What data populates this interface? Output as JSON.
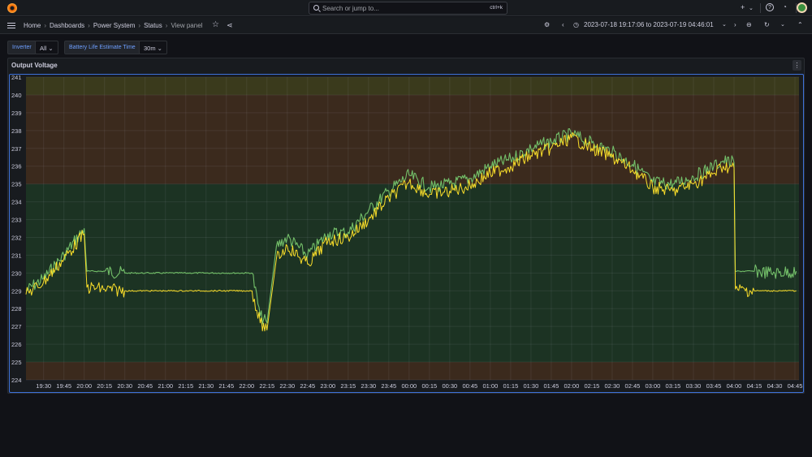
{
  "topbar": {
    "search_placeholder": "Search or jump to...",
    "search_shortcut": "ctrl+k",
    "add_label": "+",
    "help_icon": "help-icon",
    "news_icon": "rss-icon"
  },
  "breadcrumb": {
    "items": [
      "Home",
      "Dashboards",
      "Power System",
      "Status"
    ],
    "current": "View panel"
  },
  "timepicker": {
    "range": "2023-07-18 19:17:06 to 2023-07-19 04:46:01"
  },
  "variables": [
    {
      "label": "Inverter",
      "value": "All"
    },
    {
      "label": "Battery Life Estimate Time",
      "value": "30m"
    }
  ],
  "panel": {
    "title": "Output Voltage"
  },
  "colors": {
    "series_green": "#73bf69",
    "series_yellow": "#fade2a",
    "band_green": "#1c3323",
    "band_orange": "#3b2a1d",
    "band_olive": "#3a3a1c",
    "accent_blue": "#3d71d9"
  },
  "chart_data": {
    "type": "line",
    "title": "Output Voltage",
    "xlabel": "",
    "ylabel": "",
    "ylim": [
      224,
      241
    ],
    "yticks": [
      224,
      225,
      226,
      227,
      228,
      229,
      230,
      231,
      232,
      233,
      234,
      235,
      236,
      237,
      238,
      239,
      240,
      241
    ],
    "xticks": [
      "19:30",
      "19:45",
      "20:00",
      "20:15",
      "20:30",
      "20:45",
      "21:00",
      "21:15",
      "21:30",
      "21:45",
      "22:00",
      "22:15",
      "22:30",
      "22:45",
      "23:00",
      "23:15",
      "23:30",
      "23:45",
      "00:00",
      "00:15",
      "00:30",
      "00:45",
      "01:00",
      "01:15",
      "01:30",
      "01:45",
      "02:00",
      "02:15",
      "02:30",
      "02:45",
      "03:00",
      "03:15",
      "03:30",
      "03:45",
      "04:00",
      "04:15",
      "04:30",
      "04:45"
    ],
    "threshold_bands": [
      {
        "from": 224,
        "to": 225,
        "color": "orange"
      },
      {
        "from": 225,
        "to": 235,
        "color": "green"
      },
      {
        "from": 235,
        "to": 240,
        "color": "orange"
      },
      {
        "from": 240,
        "to": 241,
        "color": "olive"
      }
    ],
    "x": [
      "19:17",
      "19:30",
      "19:45",
      "20:00",
      "20:02",
      "20:15",
      "20:30",
      "20:45",
      "21:00",
      "21:15",
      "21:30",
      "21:45",
      "22:00",
      "22:04",
      "22:10",
      "22:15",
      "22:22",
      "22:30",
      "22:45",
      "23:00",
      "23:15",
      "23:30",
      "23:45",
      "00:00",
      "00:15",
      "00:30",
      "00:45",
      "01:00",
      "01:15",
      "01:30",
      "01:45",
      "02:00",
      "02:15",
      "02:30",
      "02:45",
      "03:00",
      "03:15",
      "03:30",
      "03:45",
      "03:52",
      "04:00",
      "04:01",
      "04:15",
      "04:30",
      "04:46"
    ],
    "series": [
      {
        "values": [
          229.0,
          229.7,
          231.0,
          232.5,
          230.1,
          230.1,
          230.0,
          230.0,
          230.0,
          230.0,
          230.0,
          230.0,
          230.0,
          230.0,
          227.6,
          227.2,
          231.5,
          232.0,
          231.0,
          232.2,
          232.3,
          233.5,
          234.6,
          235.5,
          234.8,
          235.0,
          235.3,
          236.0,
          236.4,
          237.0,
          237.4,
          237.8,
          237.3,
          236.8,
          236.1,
          235.1,
          235.0,
          235.4,
          236.0,
          236.3,
          236.2,
          230.1,
          230.1,
          230.0,
          230.1
        ]
      },
      {
        "values": [
          228.8,
          229.5,
          230.8,
          232.2,
          229.2,
          229.1,
          229.0,
          229.0,
          229.0,
          229.0,
          229.0,
          229.0,
          229.0,
          229.0,
          227.2,
          226.8,
          230.8,
          231.5,
          230.5,
          231.8,
          232.0,
          233.0,
          234.2,
          235.1,
          234.4,
          234.6,
          234.9,
          235.6,
          236.0,
          236.6,
          237.0,
          237.6,
          237.0,
          236.5,
          235.8,
          234.8,
          234.6,
          235.0,
          235.6,
          236.0,
          235.9,
          229.1,
          229.0,
          229.0,
          229.0
        ]
      }
    ]
  }
}
